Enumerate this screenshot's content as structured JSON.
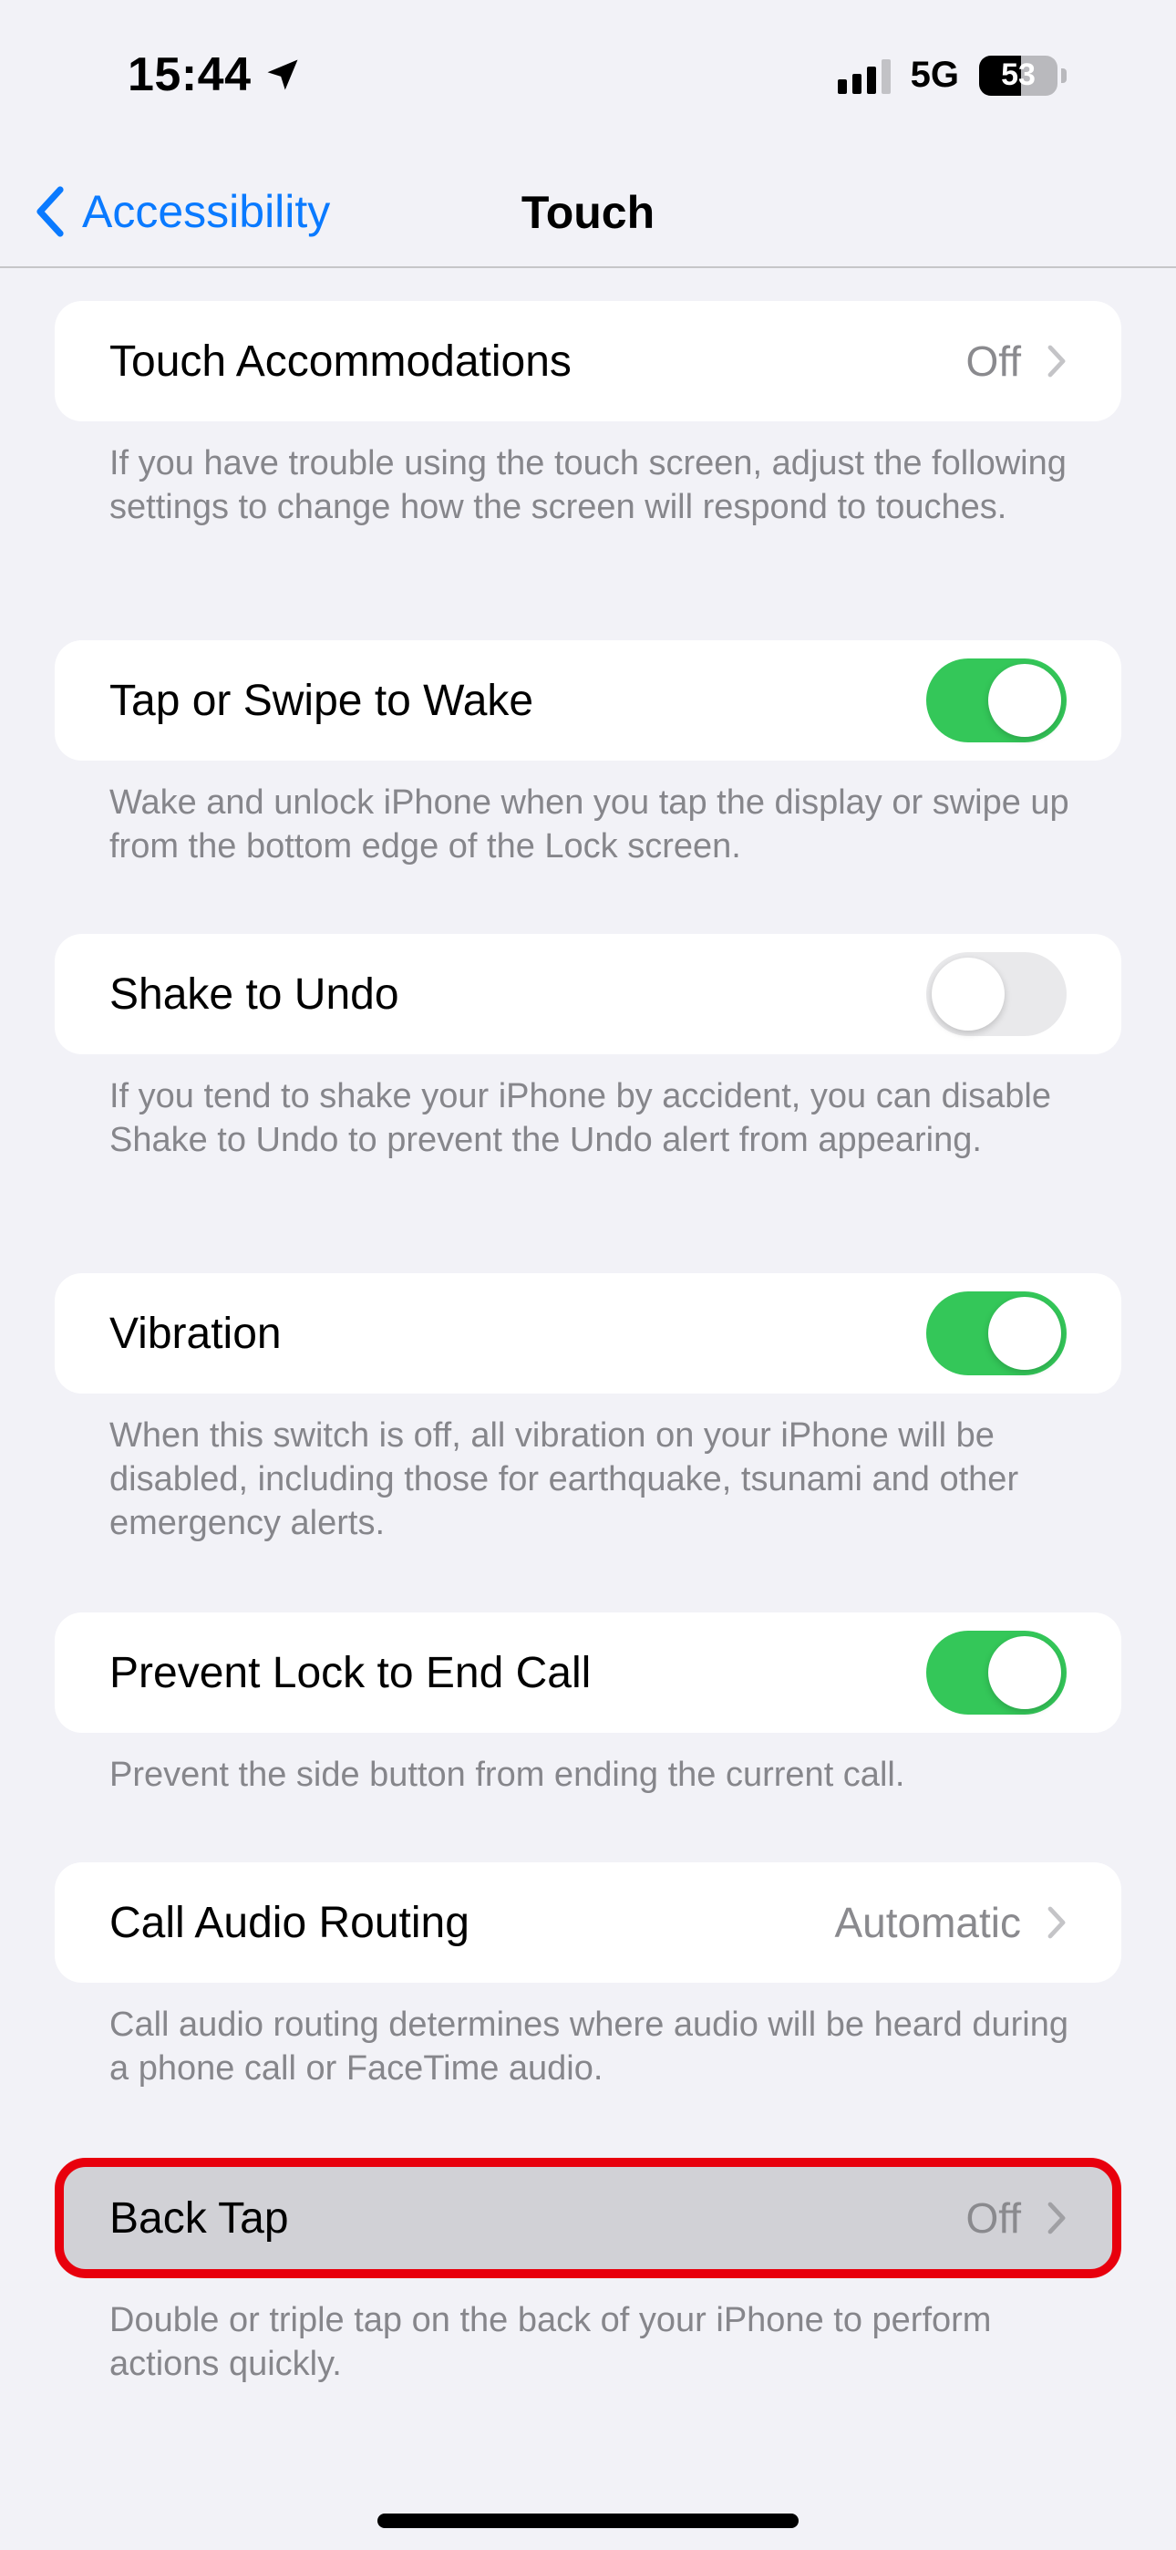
{
  "status_bar": {
    "time": "15:44",
    "network": "5G",
    "battery_percent": "53",
    "battery_level": 0.53,
    "location_icon": "location-arrow-icon",
    "signal_icon": "cellular-signal-icon"
  },
  "nav": {
    "back_label": "Accessibility",
    "title": "Touch",
    "accent_color": "#0a7aff"
  },
  "settings": {
    "touch_accommodations": {
      "label": "Touch Accommodations",
      "value": "Off",
      "footer": "If you have trouble using the touch screen, adjust the following settings to change how the screen will respond to touches."
    },
    "tap_to_wake": {
      "label": "Tap or Swipe to Wake",
      "enabled": true,
      "footer": "Wake and unlock iPhone when you tap the display or swipe up from the bottom edge of the Lock screen."
    },
    "shake_to_undo": {
      "label": "Shake to Undo",
      "enabled": false,
      "footer": "If you tend to shake your iPhone by accident, you can disable Shake to Undo to prevent the Undo alert from appearing."
    },
    "vibration": {
      "label": "Vibration",
      "enabled": true,
      "footer": "When this switch is off, all vibration on your iPhone will be disabled, including those for earthquake, tsunami and other emergency alerts."
    },
    "prevent_lock": {
      "label": "Prevent Lock to End Call",
      "enabled": true,
      "footer": "Prevent the side button from ending the current call."
    },
    "call_audio_routing": {
      "label": "Call Audio Routing",
      "value": "Automatic",
      "footer": "Call audio routing determines where audio will be heard during a phone call or FaceTime audio."
    },
    "back_tap": {
      "label": "Back Tap",
      "value": "Off",
      "highlighted": true,
      "footer": "Double or triple tap on the back of your iPhone to perform actions quickly."
    }
  },
  "colors": {
    "toggle_on": "#34c759",
    "toggle_off": "#e9e9eb",
    "highlight_border": "#e8000d",
    "background": "#f2f2f7"
  }
}
